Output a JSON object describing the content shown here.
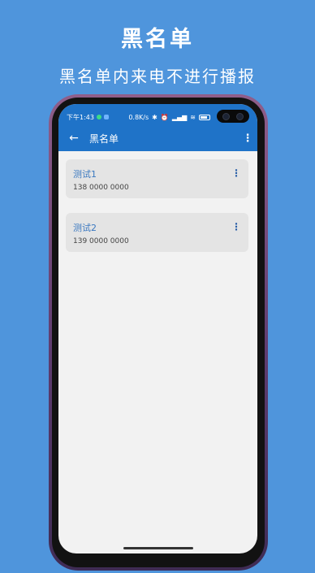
{
  "promo": {
    "title": "黑名单",
    "subtitle": "黑名单内来电不进行播报"
  },
  "statusbar": {
    "time": "下午1:43",
    "network_speed": "0.8K/s",
    "icons": [
      "bluetooth-icon",
      "alarm-icon",
      "signal-icon",
      "wifi-icon",
      "battery-icon"
    ]
  },
  "toolbar": {
    "back_icon": "←",
    "title": "黑名单",
    "menu_icon": "⋮"
  },
  "contacts": [
    {
      "name": "测试1",
      "phone": "138 0000 0000"
    },
    {
      "name": "测试2",
      "phone": "139 0000 0000"
    }
  ],
  "colors": {
    "background": "#4f95dc",
    "app_bar": "#1f73c8",
    "card": "#e4e4e4",
    "accent": "#3a78c0"
  }
}
